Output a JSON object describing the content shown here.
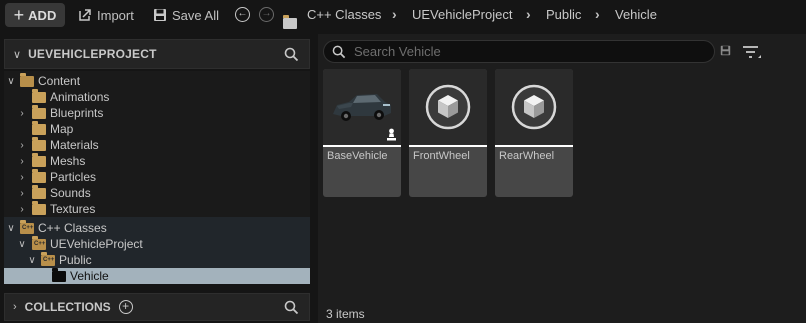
{
  "toolbar": {
    "add_label": "ADD",
    "import_label": "Import",
    "save_all_label": "Save All",
    "breadcrumbs": [
      "C++ Classes",
      "UEVehicleProject",
      "Public",
      "Vehicle"
    ]
  },
  "sources": {
    "title": "UEVEHICLEPROJECT",
    "tree": [
      {
        "label": "Content"
      },
      {
        "label": "Animations"
      },
      {
        "label": "Blueprints"
      },
      {
        "label": "Map"
      },
      {
        "label": "Materials"
      },
      {
        "label": "Meshs"
      },
      {
        "label": "Particles"
      },
      {
        "label": "Sounds"
      },
      {
        "label": "Textures"
      },
      {
        "label": "C++ Classes"
      },
      {
        "label": "UEVehicleProject"
      },
      {
        "label": "Public"
      },
      {
        "label": "Vehicle"
      }
    ]
  },
  "collections": {
    "title": "COLLECTIONS"
  },
  "content": {
    "search_placeholder": "Search Vehicle",
    "assets": [
      {
        "name": "BaseVehicle",
        "thumbnail": "car-thumbnail"
      },
      {
        "name": "FrontWheel",
        "thumbnail": "cube-icon"
      },
      {
        "name": "RearWheel",
        "thumbnail": "cube-icon"
      }
    ],
    "item_count": "3 items"
  },
  "colors": {
    "folder": "#c9a15a",
    "selection": "#a3b2bc",
    "tile": "#474747"
  }
}
